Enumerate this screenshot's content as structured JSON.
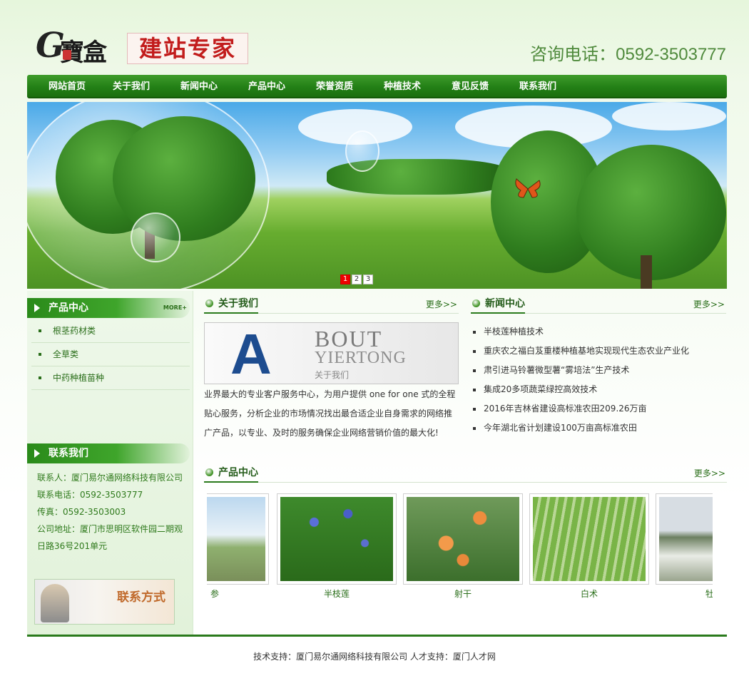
{
  "header": {
    "logo_letter": "G",
    "logo_text": "寶盒",
    "slogan": "建站专家",
    "phone": "咨询电话：0592-3503777"
  },
  "nav": {
    "items": [
      "网站首页",
      "关于我们",
      "新闻中心",
      "产品中心",
      "荣誉资质",
      "种植技术",
      "意见反馈",
      "联系我们"
    ]
  },
  "banner": {
    "pager": [
      "1",
      "2",
      "3"
    ],
    "active_page": "1"
  },
  "sidebar": {
    "products_title": "产品中心",
    "more_label": "MORE+",
    "categories": [
      "根茎药材类",
      "全草类",
      "中药种植苗种"
    ],
    "contact_title": "联系我们",
    "contact": {
      "person": "联系人：厦门易尔通网络科技有限公司",
      "tel": "联系电话：0592-3503777",
      "fax": "传真：0592-3503003",
      "address": "公司地址：厦门市思明区软件园二期观日路36号201单元"
    },
    "contact_button": "联系方式"
  },
  "about": {
    "title": "关于我们",
    "more": "更多>>",
    "image_letter": "A",
    "image_line1": "BOUT",
    "image_line2": "YIERTONG",
    "image_line3": "关于我们",
    "text": "业界最大的专业客户服务中心，为用户提供 one for one 式的全程贴心服务，分析企业的市场情况找出最合适企业自身需求的网络推广产品，以专业、及时的服务确保企业网络营销价值的最大化!"
  },
  "news": {
    "title": "新闻中心",
    "more": "更多>>",
    "items": [
      "半枝莲种植技术",
      "重庆农之福白芨重楼种植基地实现现代生态农业产业化",
      "肃引进马铃薯微型薯“雾培法”生产技术",
      "集成20多项蔬菜绿控高效技术",
      "2016年吉林省建设高标准农田209.26万亩",
      "今年湖北省计划建设100万亩高标准农田"
    ]
  },
  "products": {
    "title": "产品中心",
    "more": "更多>>",
    "items": [
      {
        "name": "参"
      },
      {
        "name": "半枝莲"
      },
      {
        "name": "射干"
      },
      {
        "name": "白术"
      },
      {
        "name": "牡"
      }
    ]
  },
  "footer": {
    "text": "技术支持：厦门易尔通网络科技有限公司 人才支持：厦门人才网"
  },
  "colors": {
    "brand_green": "#2a7a1c",
    "nav_green": "#238016",
    "slogan_red": "#c21c1c",
    "phone_green": "#4f8a3c"
  }
}
